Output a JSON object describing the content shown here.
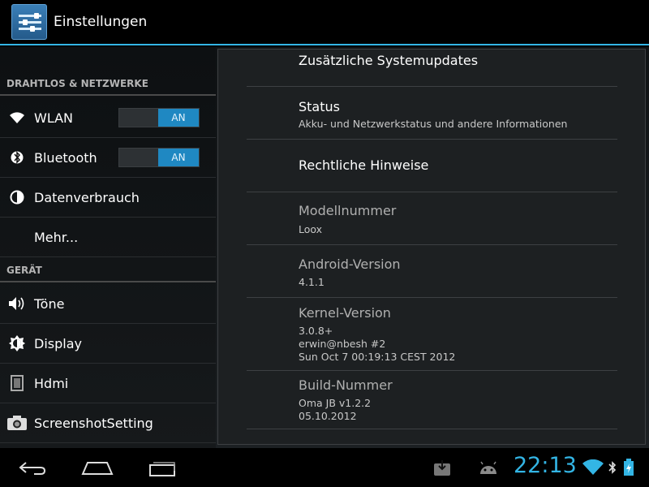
{
  "actionbar": {
    "title": "Einstellungen"
  },
  "left": {
    "sections": [
      {
        "header": "DRAHTLOS & NETZWERKE"
      },
      {
        "header": "GERÄT"
      }
    ],
    "items": [
      {
        "label": "WLAN",
        "icon": "wifi-icon",
        "toggle": "AN"
      },
      {
        "label": "Bluetooth",
        "icon": "bluetooth-icon",
        "toggle": "AN"
      },
      {
        "label": "Datenverbrauch",
        "icon": "data-usage-icon"
      },
      {
        "label": "Mehr...",
        "icon": ""
      },
      {
        "label": "Töne",
        "icon": "speaker-icon"
      },
      {
        "label": "Display",
        "icon": "brightness-icon"
      },
      {
        "label": "Hdmi",
        "icon": "hdmi-icon"
      },
      {
        "label": "ScreenshotSetting",
        "icon": "camera-icon"
      }
    ]
  },
  "right": {
    "items": [
      {
        "title": "Zusätzliche Systemupdates"
      },
      {
        "title": "Status",
        "summary": "Akku- und Netzwerkstatus und andere Informationen"
      },
      {
        "title": "Rechtliche Hinweise"
      },
      {
        "title": "Modellnummer",
        "summary": "Loox"
      },
      {
        "title": "Android-Version",
        "summary": "4.1.1"
      },
      {
        "title": "Kernel-Version",
        "lines": [
          "3.0.8+",
          "erwin@nbesh #2",
          "Sun Oct 7 00:19:13 CEST 2012"
        ]
      },
      {
        "title": "Build-Nummer",
        "lines": [
          "Oma JB v1.2.2",
          "05.10.2012"
        ]
      }
    ]
  },
  "statusbar": {
    "time": "22:13"
  },
  "colors": {
    "accent": "#33b5e5",
    "toggle_on": "#1f88c2"
  }
}
